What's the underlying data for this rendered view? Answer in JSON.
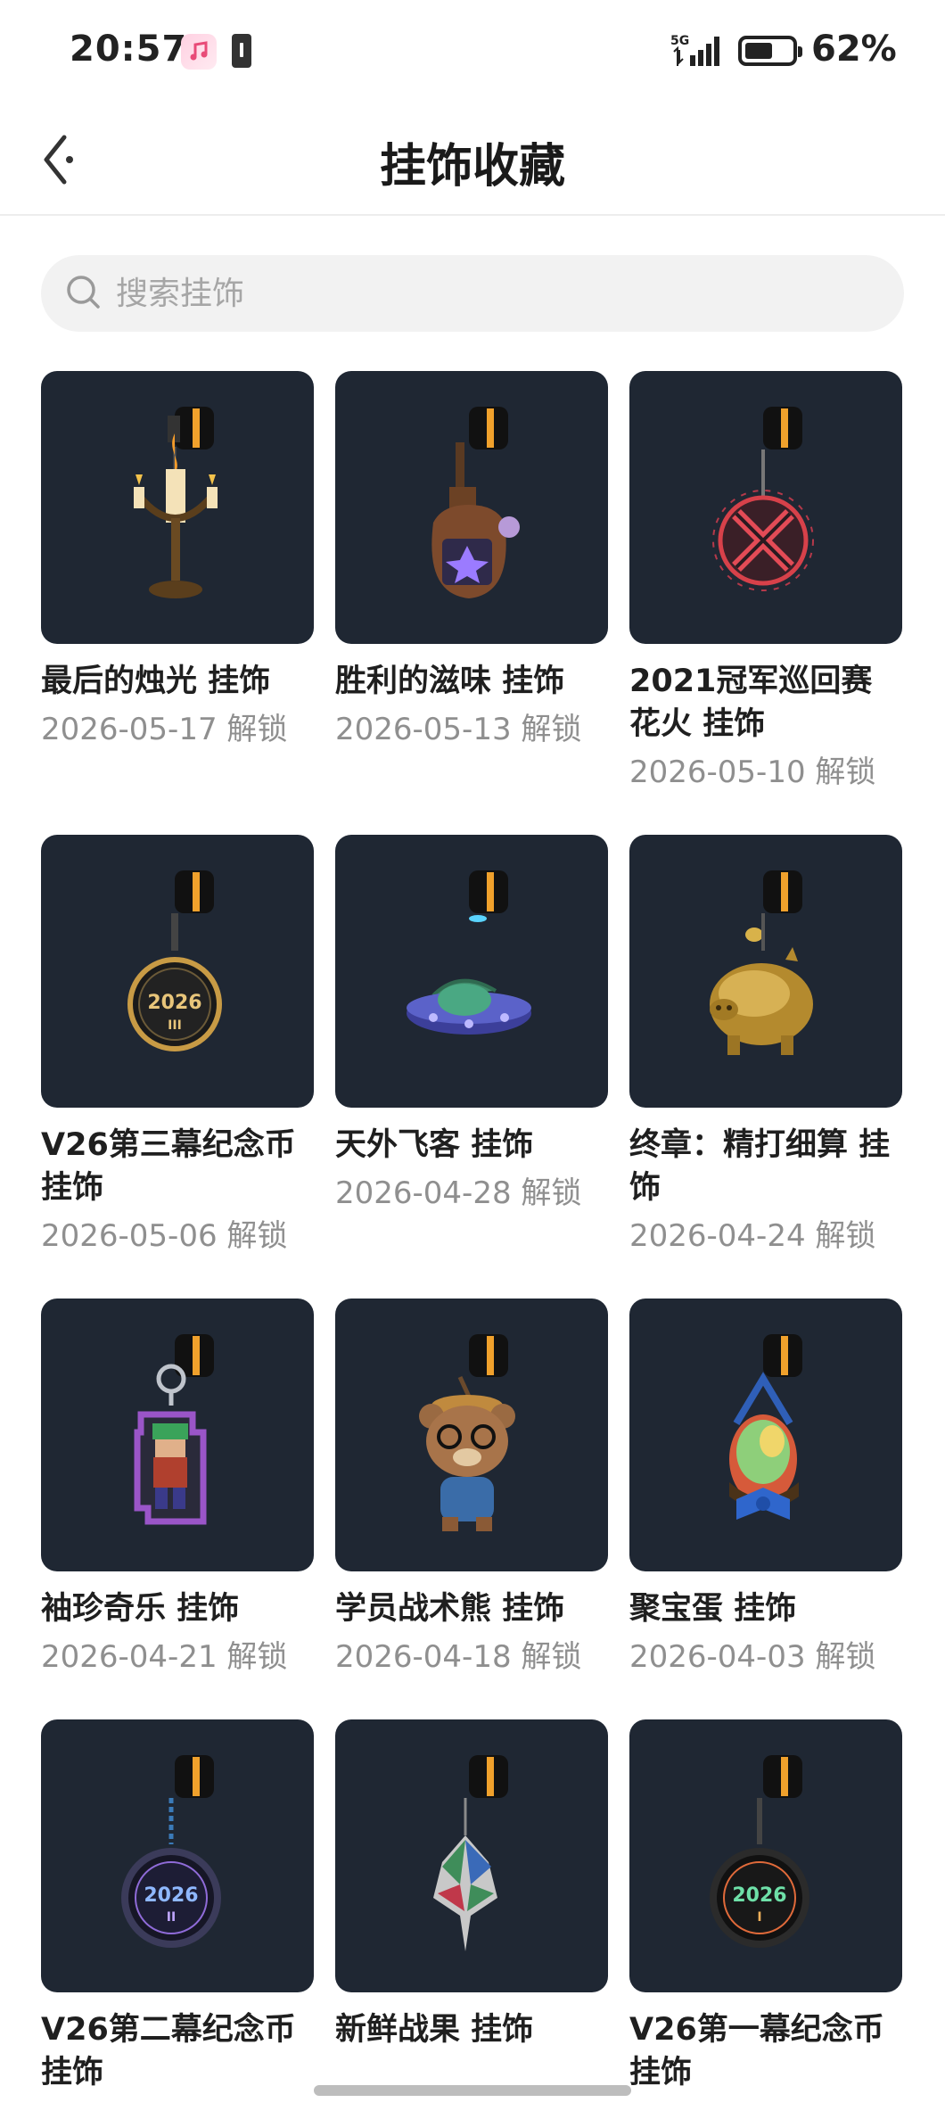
{
  "status_bar": {
    "time": "20:57",
    "network": "5G",
    "battery": "62%"
  },
  "header": {
    "title": "挂饰收藏"
  },
  "search": {
    "placeholder": "搜索挂饰"
  },
  "items": [
    {
      "name": "最后的烛光 挂饰",
      "date": "2026-05-17 解锁",
      "icon": "candelabra"
    },
    {
      "name": "胜利的滋味 挂饰",
      "date": "2026-05-13 解锁",
      "icon": "potion-bottle"
    },
    {
      "name": "2021冠军巡回赛花火 挂饰",
      "date": "2026-05-10 解锁",
      "icon": "firework-x-emblem"
    },
    {
      "name": "V26第三幕纪念币 挂饰",
      "date": "2026-05-06 解锁",
      "icon": "coin-2026-iii"
    },
    {
      "name": "天外飞客 挂饰",
      "date": "2026-04-28 解锁",
      "icon": "ufo"
    },
    {
      "name": "终章：精打细算 挂饰",
      "date": "2026-04-24 解锁",
      "icon": "piggy-bank"
    },
    {
      "name": "袖珍奇乐 挂饰",
      "date": "2026-04-21 解锁",
      "icon": "pixel-character"
    },
    {
      "name": "学员战术熊 挂饰",
      "date": "2026-04-18 解锁",
      "icon": "bear"
    },
    {
      "name": "聚宝蛋 挂饰",
      "date": "2026-04-03 解锁",
      "icon": "egg-basket"
    },
    {
      "name": "V26第二幕纪念币 挂饰",
      "date": "",
      "icon": "coin-2026-ii"
    },
    {
      "name": "新鲜战果 挂饰",
      "date": "",
      "icon": "leaf-fruit"
    },
    {
      "name": "V26第一幕纪念币 挂饰",
      "date": "",
      "icon": "coin-2026-i"
    }
  ],
  "colors": {
    "thumb_bg": "#1f2733",
    "search_bg": "#f2f2f2",
    "date_text": "#8f8f8f"
  }
}
